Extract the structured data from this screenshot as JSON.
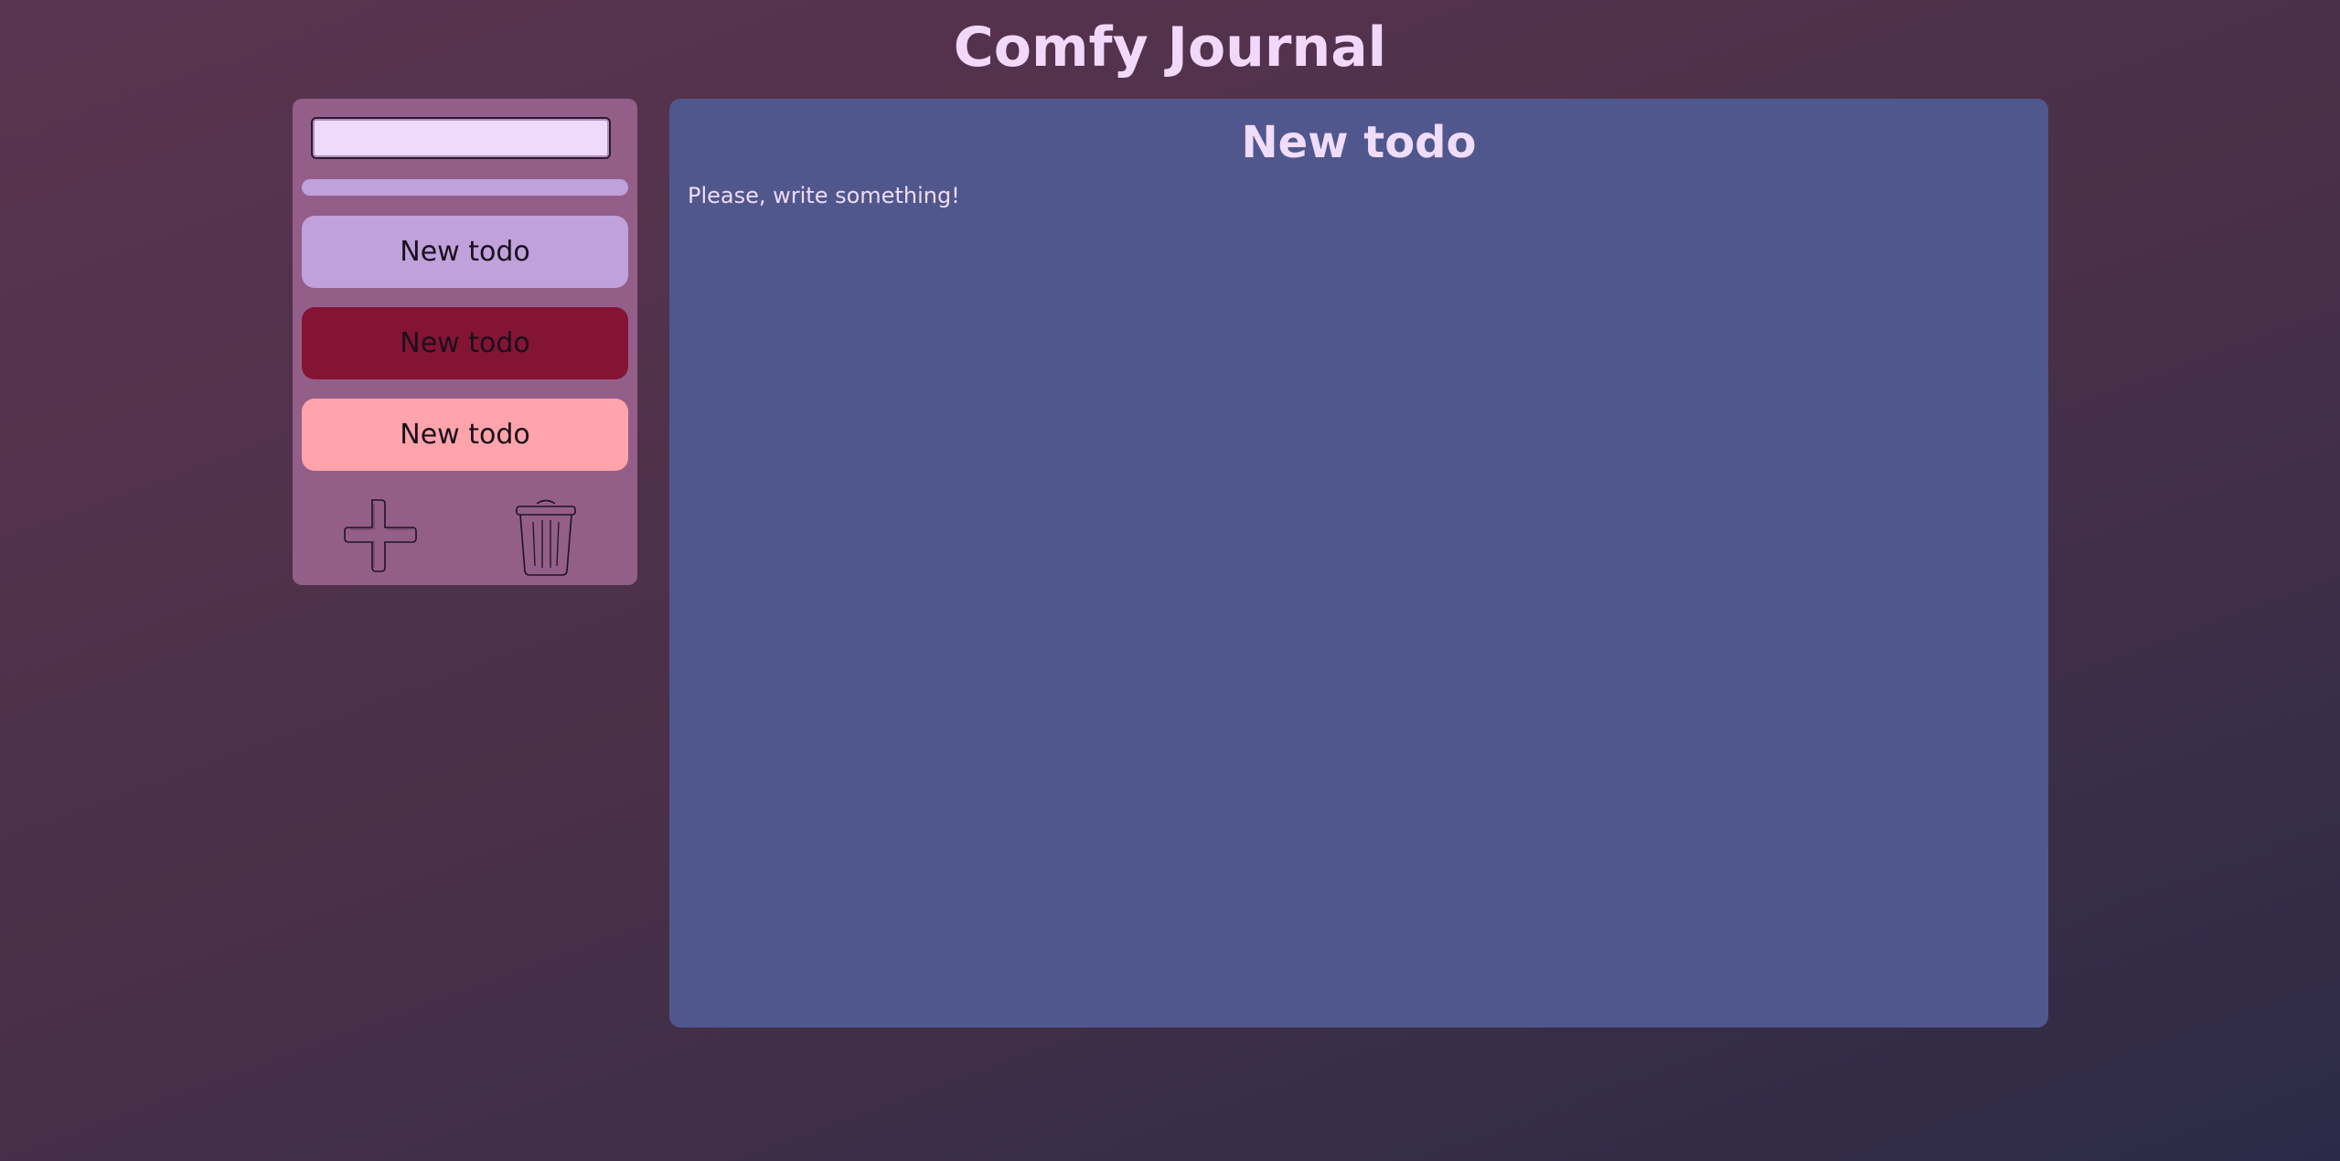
{
  "app": {
    "title": "Comfy Journal"
  },
  "sidebar": {
    "title_input": {
      "value": "",
      "placeholder": ""
    },
    "color_bar": {
      "color": "#bfa1dc"
    },
    "todos": [
      {
        "label": "New todo",
        "color": "#c0a1dc"
      },
      {
        "label": "New todo",
        "color": "#841434"
      },
      {
        "label": "New todo",
        "color": "#ffa4aa"
      }
    ],
    "actions": {
      "add_icon": "plus-icon",
      "delete_icon": "trash-icon"
    }
  },
  "editor": {
    "title": "New todo",
    "body": "Please, write something!"
  },
  "colors": {
    "accent_text": "#f2d9fb",
    "sidebar_bg": "#935f89",
    "editor_bg": "#50578c"
  }
}
